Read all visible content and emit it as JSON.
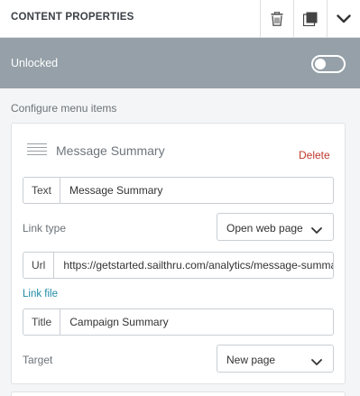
{
  "header": {
    "title": "CONTENT PROPERTIES",
    "buttons": [
      "trash-icon",
      "copy-icon",
      "chevron-down-icon"
    ]
  },
  "lock": {
    "label": "Unlocked",
    "locked": false
  },
  "section": {
    "label": "Configure menu items"
  },
  "menu_item": {
    "title": "Message Summary",
    "delete_label": "Delete",
    "text_label": "Text",
    "text_value": "Message Summary",
    "link_type_label": "Link type",
    "link_type_value": "Open web page",
    "url_label": "Url",
    "url_value": "https://getstarted.sailthru.com/analytics/message-summary",
    "link_file_label": "Link file",
    "title_label": "Title",
    "title_value": "Campaign Summary",
    "target_label": "Target",
    "target_value": "New page"
  },
  "colors": {
    "lockbar": "#95a0a8",
    "delete": "#c0392b",
    "link": "#1f8ba6"
  }
}
